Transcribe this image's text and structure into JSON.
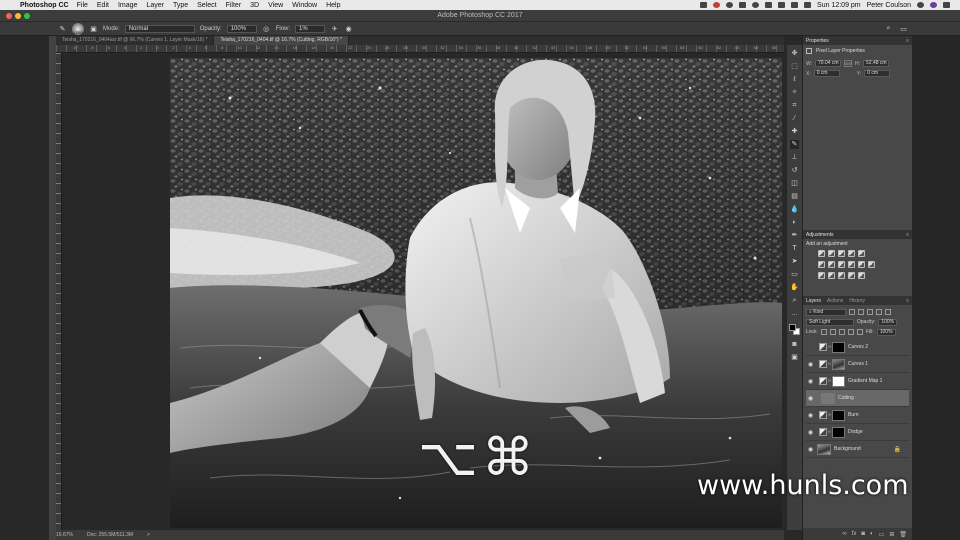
{
  "menubar": {
    "apple": "",
    "app_name": "Photoshop CC",
    "items": [
      "File",
      "Edit",
      "Image",
      "Layer",
      "Type",
      "Select",
      "Filter",
      "3D",
      "View",
      "Window",
      "Help"
    ],
    "clock": "Sun 12:09 pm",
    "user": "Peter Coulson"
  },
  "window": {
    "title": "Adobe Photoshop CC 2017"
  },
  "options": {
    "brush_size": "1200",
    "mode_label": "Mode:",
    "mode_value": "Normal",
    "opacity_label": "Opacity:",
    "opacity_value": "100%",
    "flow_label": "Flow:",
    "flow_value": "1%"
  },
  "tabs": [
    {
      "label": "Teisha_170216_0404acr.tif @ 66.7% (Curves 1, Layer Mask/16) *"
    },
    {
      "label": "Teisha_170216_0404.tif @ 16.7% (Cutting, RGB/16*) *"
    }
  ],
  "ruler": {
    "numbers": [
      "10",
      "8",
      "6",
      "4",
      "2",
      "0",
      "2",
      "4",
      "6",
      "8",
      "10",
      "12",
      "14",
      "16",
      "18",
      "20",
      "22",
      "24",
      "26",
      "28",
      "30",
      "32",
      "34",
      "36",
      "38",
      "40",
      "42",
      "44",
      "46",
      "48",
      "50",
      "52",
      "54",
      "56",
      "58",
      "60",
      "62",
      "64",
      "66",
      "68"
    ]
  },
  "status": {
    "zoom": "16.67%",
    "doc": "Doc: 255.5M/511.3M",
    "arrow": ">"
  },
  "properties": {
    "header": "Properties",
    "title": "Pixel Layer Properties",
    "w_label": "W:",
    "w_value": "70.04 cm",
    "go_label": "GO",
    "h_label": "H:",
    "h_value": "52.48 cm",
    "x_label": "X:",
    "x_value": "0 cm",
    "y_label": "Y:",
    "y_value": "0 cm"
  },
  "adjustments": {
    "header": "Adjustments",
    "subtitle": "Add an adjustment"
  },
  "layers_panel": {
    "tabs": [
      "Layers",
      "Actions",
      "History"
    ],
    "kind_label": "Kind",
    "blend_mode": "Soft Light",
    "opacity_label": "Opacity:",
    "opacity_value": "100%",
    "lock_label": "Lock:",
    "fill_label": "Fill:",
    "fill_value": "100%",
    "layers": [
      {
        "name": "Curves 2",
        "kind": "adjustment",
        "mask": "black",
        "visible": false
      },
      {
        "name": "Curves 1",
        "kind": "adjustment",
        "mask": "photo",
        "visible": true
      },
      {
        "name": "Gradient Map 1",
        "kind": "adjustment",
        "mask": "white",
        "visible": true
      },
      {
        "name": "Cutting",
        "kind": "pixel",
        "mask": "gray",
        "visible": true,
        "active": true
      },
      {
        "name": "Burn",
        "kind": "adjustment",
        "mask": "black",
        "visible": true
      },
      {
        "name": "Dodge",
        "kind": "adjustment",
        "mask": "black",
        "visible": true
      },
      {
        "name": "Background",
        "kind": "background",
        "mask": "photo",
        "visible": true,
        "locked": true
      }
    ]
  },
  "overlay": {
    "keys": "⌥⌘",
    "watermark": "www.hunls.com"
  },
  "icons": {
    "eye": "eye-icon",
    "lock": "lock-icon",
    "brush": "brush-icon",
    "search": "search-icon"
  }
}
